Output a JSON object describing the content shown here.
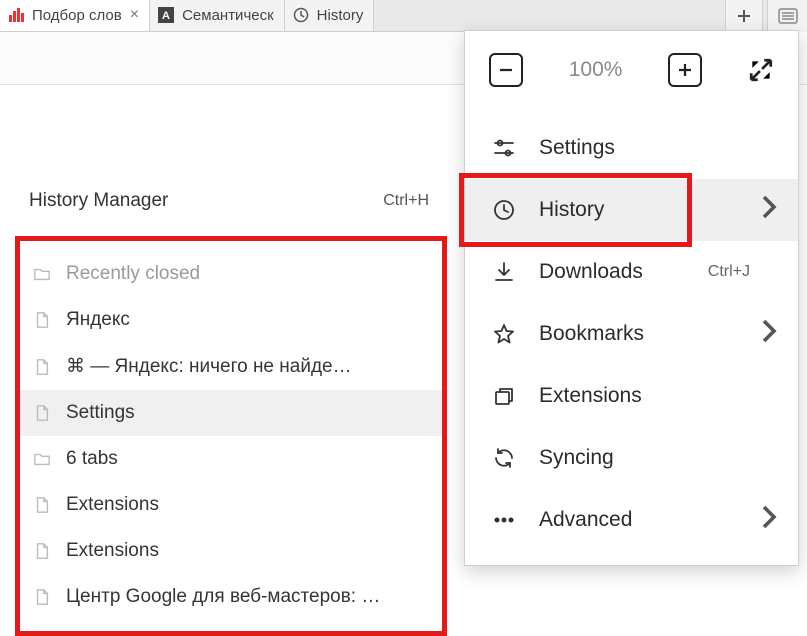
{
  "tabs": [
    {
      "label": "Подбор слов",
      "icon": "bars-red",
      "closable": true,
      "active": true
    },
    {
      "label": "Семантическ",
      "icon": "letter-a",
      "closable": false,
      "active": false
    },
    {
      "label": "History",
      "icon": "clock",
      "closable": false,
      "active": false
    }
  ],
  "zoom": {
    "value": "100%"
  },
  "menu": {
    "items": [
      {
        "key": "settings",
        "label": "Settings",
        "icon": "sliders"
      },
      {
        "key": "history",
        "label": "History",
        "icon": "clock",
        "submenu": true,
        "highlighted": true
      },
      {
        "key": "downloads",
        "label": "Downloads",
        "icon": "download",
        "shortcut": "Ctrl+J"
      },
      {
        "key": "bookmarks",
        "label": "Bookmarks",
        "icon": "star",
        "submenu": true
      },
      {
        "key": "extensions",
        "label": "Extensions",
        "icon": "stack"
      },
      {
        "key": "syncing",
        "label": "Syncing",
        "icon": "sync"
      },
      {
        "key": "advanced",
        "label": "Advanced",
        "icon": "dots",
        "submenu": true
      }
    ]
  },
  "history_panel": {
    "title": "History Manager",
    "shortcut": "Ctrl+H",
    "items": [
      {
        "label": "Recently closed",
        "icon": "folder",
        "muted": true
      },
      {
        "label": "Яндекс",
        "icon": "page"
      },
      {
        "label": "⌘ — Яндекс: ничего не найде…",
        "icon": "page"
      },
      {
        "label": "Settings",
        "icon": "page",
        "hover": true
      },
      {
        "label": "6 tabs",
        "icon": "folder"
      },
      {
        "label": "Extensions",
        "icon": "page"
      },
      {
        "label": "Extensions",
        "icon": "page"
      },
      {
        "label": "Центр Google для веб-мастеров: …",
        "icon": "page"
      }
    ]
  },
  "colors": {
    "highlight": "#e21a1a"
  }
}
